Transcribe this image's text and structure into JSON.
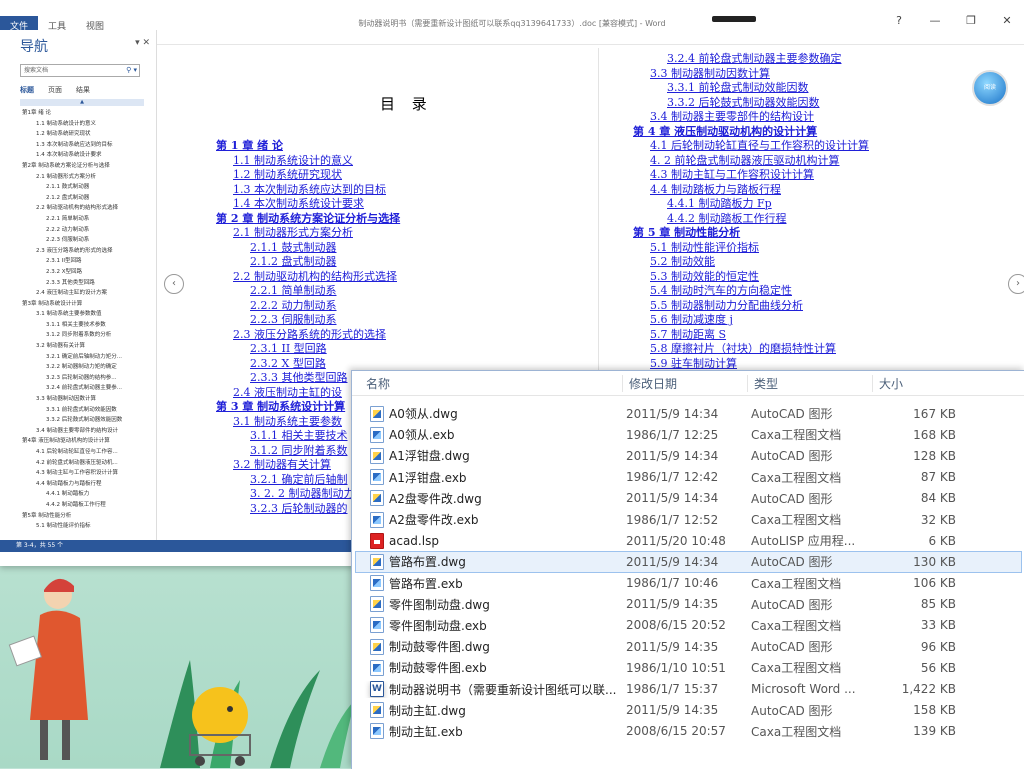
{
  "word": {
    "ribbon_tabs": [
      "文件",
      "工具",
      "视图"
    ],
    "title": "制动器说明书（需要重新设计图纸可以联系qq3139641733）.doc [兼容模式] - Word",
    "window_controls": [
      "?",
      "—",
      "❐",
      "✕"
    ],
    "nav": {
      "title": "导航",
      "search_placeholder": "搜索文档",
      "tabs": [
        "标题",
        "页面",
        "结果"
      ],
      "items": [
        {
          "level": 1,
          "text": "第1章 绪 论"
        },
        {
          "level": 2,
          "text": "1.1 制动系统设计的意义"
        },
        {
          "level": 2,
          "text": "1.2 制动系统研究现状"
        },
        {
          "level": 2,
          "text": "1.3 本次制动系统应达到的目标"
        },
        {
          "level": 2,
          "text": "1.4 本次制动系统设计要求"
        },
        {
          "level": 1,
          "text": "第2章 制动系统方案论证分析与选择"
        },
        {
          "level": 2,
          "text": "2.1 制动器形式方案分析"
        },
        {
          "level": 3,
          "text": "2.1.1 鼓式制动器"
        },
        {
          "level": 3,
          "text": "2.1.2 盘式制动器"
        },
        {
          "level": 2,
          "text": "2.2 制动驱动机构的结构形式选择"
        },
        {
          "level": 3,
          "text": "2.2.1 简单制动系"
        },
        {
          "level": 3,
          "text": "2.2.2 动力制动系"
        },
        {
          "level": 3,
          "text": "2.2.3 伺服制动系"
        },
        {
          "level": 2,
          "text": "2.3 液压分路系统的形式的选择"
        },
        {
          "level": 3,
          "text": "2.3.1 II型回路"
        },
        {
          "level": 3,
          "text": "2.3.2 X型回路"
        },
        {
          "level": 3,
          "text": "2.3.3 其他类型回路"
        },
        {
          "level": 2,
          "text": "2.4 液压制动主缸的设计方案"
        },
        {
          "level": 1,
          "text": "第3章 制动系统设计计算"
        },
        {
          "level": 2,
          "text": "3.1 制动系统主要参数数值"
        },
        {
          "level": 3,
          "text": "3.1.1 相关主要技术参数"
        },
        {
          "level": 3,
          "text": "3.1.2 同步附着系数的分析"
        },
        {
          "level": 2,
          "text": "3.2 制动器有关计算"
        },
        {
          "level": 3,
          "text": "3.2.1 确定前后轴制动力矩分..."
        },
        {
          "level": 3,
          "text": "3.2.2 制动器制动力矩的确定"
        },
        {
          "level": 3,
          "text": "3.2.3 后轮制动器的结构参..."
        },
        {
          "level": 3,
          "text": "3.2.4 前轮盘式制动器主要参..."
        },
        {
          "level": 2,
          "text": "3.3 制动器制动因数计算"
        },
        {
          "level": 3,
          "text": "3.3.1 前轮盘式制动效能因数"
        },
        {
          "level": 3,
          "text": "3.3.2 后轮鼓式制动器效能因数"
        },
        {
          "level": 2,
          "text": "3.4 制动器主要零部件的结构设计"
        },
        {
          "level": 1,
          "text": "第4章 液压制动驱动机构的设计计算"
        },
        {
          "level": 2,
          "text": "4.1 后轮制动轮缸直径与工作容..."
        },
        {
          "level": 2,
          "text": "4.2 前轮盘式制动器液压驱动机..."
        },
        {
          "level": 2,
          "text": "4.3 制动主缸与工作容积设计计算"
        },
        {
          "level": 2,
          "text": "4.4 制动踏板力与踏板行程"
        },
        {
          "level": 3,
          "text": "4.4.1 制动踏板力"
        },
        {
          "level": 3,
          "text": "4.4.2 制动踏板工作行程"
        },
        {
          "level": 1,
          "text": "第5章 制动性能分析"
        },
        {
          "level": 2,
          "text": "5.1 制动性能评价指标"
        }
      ]
    },
    "status": "第 3-4，共 55 个",
    "toc_heading": "目 录",
    "toc_left": [
      {
        "ch": true,
        "text": "第 1 章 绪 论"
      },
      {
        "ch": false,
        "ind": 1,
        "text": "1.1 制动系统设计的意义"
      },
      {
        "ch": false,
        "ind": 1,
        "text": "1.2 制动系统研究现状"
      },
      {
        "ch": false,
        "ind": 1,
        "text": "1.3 本次制动系统应达到的目标"
      },
      {
        "ch": false,
        "ind": 1,
        "text": "1.4 本次制动系统设计要求"
      },
      {
        "ch": true,
        "text": "第 2 章 制动系统方案论证分析与选择"
      },
      {
        "ch": false,
        "ind": 1,
        "text": "2.1 制动器形式方案分析"
      },
      {
        "ch": false,
        "ind": 2,
        "text": "2.1.1 鼓式制动器"
      },
      {
        "ch": false,
        "ind": 2,
        "text": "2.1.2 盘式制动器"
      },
      {
        "ch": false,
        "ind": 1,
        "text": "2.2 制动驱动机构的结构形式选择"
      },
      {
        "ch": false,
        "ind": 2,
        "text": "2.2.1 简单制动系"
      },
      {
        "ch": false,
        "ind": 2,
        "text": "2.2.2 动力制动系"
      },
      {
        "ch": false,
        "ind": 2,
        "text": "2.2.3 伺服制动系"
      },
      {
        "ch": false,
        "ind": 1,
        "text": "2.3 液压分路系统的形式的选择"
      },
      {
        "ch": false,
        "ind": 2,
        "text": "2.3.1 II 型回路"
      },
      {
        "ch": false,
        "ind": 2,
        "text": "2.3.2 X 型回路"
      },
      {
        "ch": false,
        "ind": 2,
        "text": "2.3.3 其他类型回路"
      },
      {
        "ch": false,
        "ind": 1,
        "text": "2.4 液压制动主缸的设"
      },
      {
        "ch": true,
        "text": "第 3 章 制动系统设计计算"
      },
      {
        "ch": false,
        "ind": 1,
        "text": "3.1 制动系统主要参数"
      },
      {
        "ch": false,
        "ind": 2,
        "text": "3.1.1 相关主要技术"
      },
      {
        "ch": false,
        "ind": 2,
        "text": "3.1.2 同步附着系数"
      },
      {
        "ch": false,
        "ind": 1,
        "text": "3.2 制动器有关计算"
      },
      {
        "ch": false,
        "ind": 2,
        "text": "3.2.1 确定前后轴制"
      },
      {
        "ch": false,
        "ind": 2,
        "text": "3. 2. 2 制动器制动力"
      },
      {
        "ch": false,
        "ind": 2,
        "text": "3.2.3 后轮制动器的"
      }
    ],
    "toc_right": [
      {
        "ch": false,
        "ind": 2,
        "text": "3.2.4 前轮盘式制动器主要参数确定"
      },
      {
        "ch": false,
        "ind": 1,
        "text": "3.3 制动器制动因数计算"
      },
      {
        "ch": false,
        "ind": 2,
        "text": "3.3.1 前轮盘式制动效能因数"
      },
      {
        "ch": false,
        "ind": 2,
        "text": "3.3.2 后轮鼓式制动器效能因数"
      },
      {
        "ch": false,
        "ind": 1,
        "text": "3.4 制动器主要零部件的结构设计"
      },
      {
        "ch": true,
        "text": "第 4 章 液压制动驱动机构的设计计算"
      },
      {
        "ch": false,
        "ind": 1,
        "text": "4.1 后轮制动轮缸直径与工作容积的设计计算"
      },
      {
        "ch": false,
        "ind": 1,
        "text": "4. 2 前轮盘式制动器液压驱动机构计算"
      },
      {
        "ch": false,
        "ind": 1,
        "text": "4.3 制动主缸与工作容积设计计算"
      },
      {
        "ch": false,
        "ind": 1,
        "text": "4.4 制动踏板力与踏板行程"
      },
      {
        "ch": false,
        "ind": 2,
        "text": "4.4.1 制动踏板力 Fp"
      },
      {
        "ch": false,
        "ind": 2,
        "text": "4.4.2 制动踏板工作行程"
      },
      {
        "ch": true,
        "text": "第 5 章 制动性能分析"
      },
      {
        "ch": false,
        "ind": 1,
        "text": "5.1 制动性能评价指标"
      },
      {
        "ch": false,
        "ind": 1,
        "text": "5.2 制动效能"
      },
      {
        "ch": false,
        "ind": 1,
        "text": "5.3 制动效能的恒定性"
      },
      {
        "ch": false,
        "ind": 1,
        "text": "5.4 制动时汽车的方向稳定性"
      },
      {
        "ch": false,
        "ind": 1,
        "text": "5.5 制动器制动力分配曲线分析"
      },
      {
        "ch": false,
        "ind": 1,
        "text": "5.6 制动减速度 j"
      },
      {
        "ch": false,
        "ind": 1,
        "text": "5.7 制动距离 S"
      },
      {
        "ch": false,
        "ind": 1,
        "text": "5.8 摩擦衬片（衬块）的磨损特性计算"
      },
      {
        "ch": false,
        "ind": 1,
        "text": "5.9 驻车制动计算"
      }
    ],
    "read_badge": "阅读"
  },
  "explorer": {
    "columns": {
      "name": "名称",
      "date": "修改日期",
      "type": "类型",
      "size": "大小"
    },
    "files": [
      {
        "name": "A0领从.dwg",
        "date": "2011/5/9 14:34",
        "type": "AutoCAD 图形",
        "size": "167 KB",
        "icon": "dwg"
      },
      {
        "name": "A0领从.exb",
        "date": "1986/1/7 12:25",
        "type": "Caxa工程图文档",
        "size": "168 KB",
        "icon": "exb"
      },
      {
        "name": "A1浮钳盘.dwg",
        "date": "2011/5/9 14:34",
        "type": "AutoCAD 图形",
        "size": "128 KB",
        "icon": "dwg"
      },
      {
        "name": "A1浮钳盘.exb",
        "date": "1986/1/7 12:42",
        "type": "Caxa工程图文档",
        "size": "87 KB",
        "icon": "exb"
      },
      {
        "name": "A2盘零件改.dwg",
        "date": "2011/5/9 14:34",
        "type": "AutoCAD 图形",
        "size": "84 KB",
        "icon": "dwg"
      },
      {
        "name": "A2盘零件改.exb",
        "date": "1986/1/7 12:52",
        "type": "Caxa工程图文档",
        "size": "32 KB",
        "icon": "exb"
      },
      {
        "name": "acad.lsp",
        "date": "2011/5/20 10:48",
        "type": "AutoLISP 应用程...",
        "size": "6 KB",
        "icon": "lsp"
      },
      {
        "name": "管路布置.dwg",
        "date": "2011/5/9 14:34",
        "type": "AutoCAD 图形",
        "size": "130 KB",
        "icon": "dwg",
        "selected": true
      },
      {
        "name": "管路布置.exb",
        "date": "1986/1/7 10:46",
        "type": "Caxa工程图文档",
        "size": "106 KB",
        "icon": "exb"
      },
      {
        "name": "零件图制动盘.dwg",
        "date": "2011/5/9 14:35",
        "type": "AutoCAD 图形",
        "size": "85 KB",
        "icon": "dwg"
      },
      {
        "name": "零件图制动盘.exb",
        "date": "2008/6/15 20:52",
        "type": "Caxa工程图文档",
        "size": "33 KB",
        "icon": "exb"
      },
      {
        "name": "制动鼓零件图.dwg",
        "date": "2011/5/9 14:35",
        "type": "AutoCAD 图形",
        "size": "96 KB",
        "icon": "dwg"
      },
      {
        "name": "制动鼓零件图.exb",
        "date": "1986/1/10 10:51",
        "type": "Caxa工程图文档",
        "size": "56 KB",
        "icon": "exb"
      },
      {
        "name": "制动器说明书（需要重新设计图纸可以联...",
        "date": "1986/1/7 15:37",
        "type": "Microsoft Word ...",
        "size": "1,422 KB",
        "icon": "word"
      },
      {
        "name": "制动主缸.dwg",
        "date": "2011/5/9 14:35",
        "type": "AutoCAD 图形",
        "size": "158 KB",
        "icon": "dwg"
      },
      {
        "name": "制动主缸.exb",
        "date": "2008/6/15 20:57",
        "type": "Caxa工程图文档",
        "size": "139 KB",
        "icon": "exb"
      }
    ]
  }
}
